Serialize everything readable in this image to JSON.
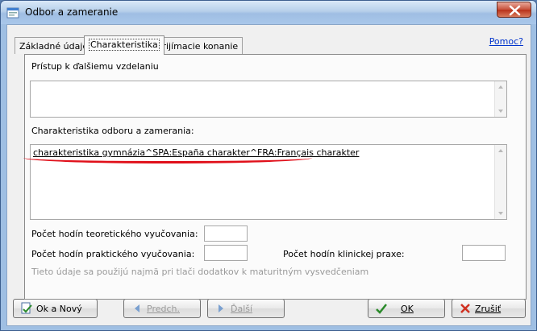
{
  "window": {
    "title": "Odbor a zameranie"
  },
  "tabs": [
    {
      "label": "Základné údaje"
    },
    {
      "label": "Charakteristika"
    },
    {
      "label": "Prijímacie konanie"
    }
  ],
  "help": {
    "label": "Pomoc?"
  },
  "fields": {
    "access_label": "Prístup k ďalšiemu vzdelaniu",
    "access_value": "",
    "characteristic_label": "Charakteristika odboru a zamerania:",
    "characteristic_value": "charakteristika gymnázia^SPA:España charakter^FRA:Français charakter",
    "theory_hours_label": "Počet hodín teoretického vyučovania:",
    "theory_hours_value": "",
    "practice_hours_label": "Počet hodín praktického vyučovania:",
    "practice_hours_value": "",
    "clinical_hours_label": "Počet hodín klinickej praxe:",
    "clinical_hours_value": "",
    "hint": "Tieto údaje sa použijú najmä pri tlači dodatkov k maturitným vysvedčeniam"
  },
  "buttons": {
    "ok_new": "Ok a Nový",
    "prev": "Predch.",
    "next": "Ďalší",
    "ok": "OK",
    "cancel": "Zrušiť"
  },
  "colors": {
    "annotation": "#e0101a",
    "link": "#0033cc",
    "title_bar": "#9fbee3"
  }
}
